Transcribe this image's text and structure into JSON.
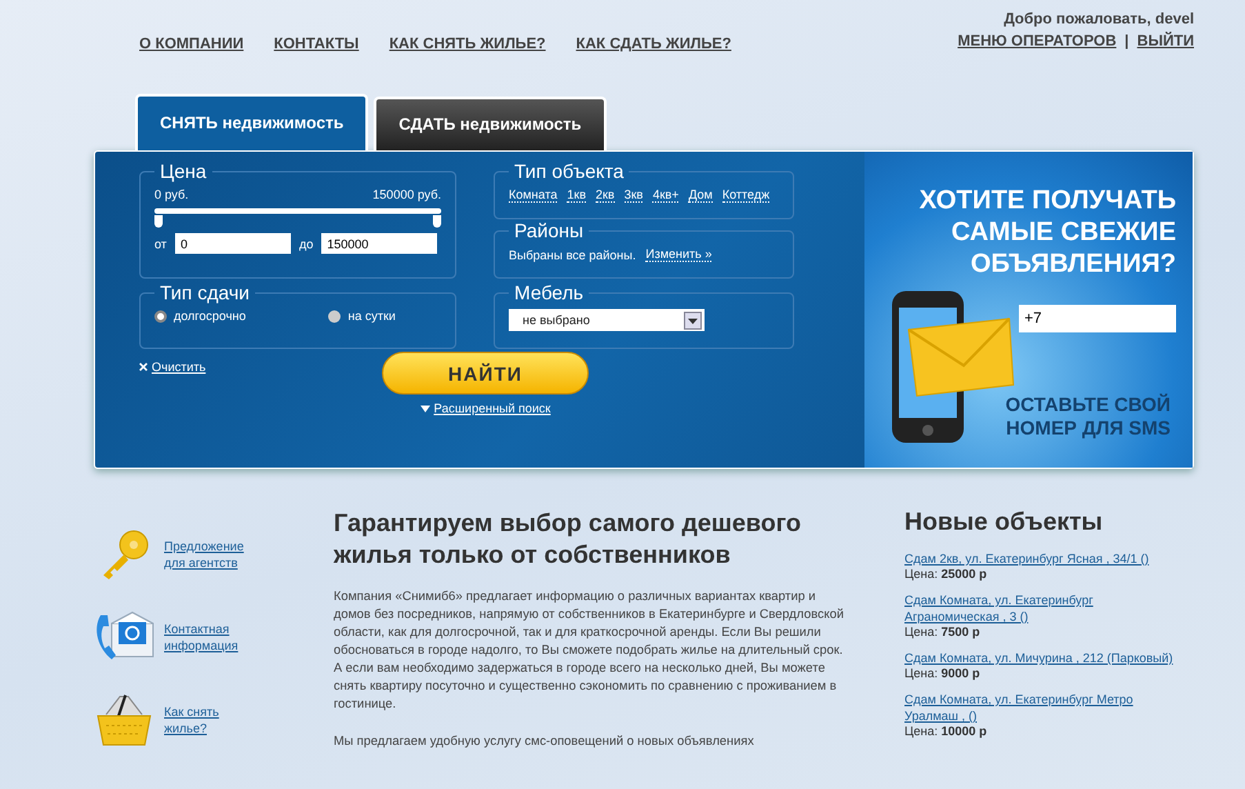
{
  "header": {
    "nav": [
      "О КОМПАНИИ",
      "КОНТАКТЫ",
      "КАК СНЯТЬ ЖИЛЬЕ?",
      "КАК СДАТЬ ЖИЛЬЕ?"
    ],
    "welcome": "Добро пожаловать, devel",
    "user_links": [
      "МЕНЮ ОПЕРАТОРОВ",
      "ВЫЙТИ"
    ],
    "separator": "|"
  },
  "tabs": [
    {
      "label": "СНЯТЬ недвижимость",
      "selected": true
    },
    {
      "label": "СДАТЬ недвижимость",
      "selected": false
    }
  ],
  "search": {
    "price": {
      "legend": "Цена",
      "min_label": "0 руб.",
      "max_label": "150000 руб.",
      "thumbs": [
        {
          "level": 0
        },
        {
          "level": 1
        }
      ],
      "from_label": "от",
      "from_value": "0",
      "to_label": "до",
      "to_value": "150000"
    },
    "rent_type": {
      "legend": "Тип сдачи",
      "options": [
        {
          "label": "долгосрочно",
          "selected": true
        },
        {
          "label": "на сутки",
          "selected": false
        }
      ]
    },
    "object_type": {
      "legend": "Тип объекта",
      "options": [
        "Комната",
        "1кв",
        "2кв",
        "3кв",
        "4кв+",
        "Дом",
        "Коттедж"
      ]
    },
    "districts": {
      "legend": "Районы",
      "text": "Выбраны все районы.",
      "link": "Изменить »"
    },
    "furniture": {
      "legend": "Мебель",
      "value": "не выбрано"
    },
    "clear": "Очистить",
    "submit": "НАЙТИ",
    "advanced": "Расширенный поиск"
  },
  "sms_banner": {
    "title": "ХОТИТЕ ПОЛУЧАТЬ САМЫЕ СВЕЖИЕ ОБЪЯВЛЕНИЯ?",
    "phone_value": "+7",
    "caption": "ОСТАВЬТЕ СВОЙ НОМЕР ДЛЯ SMS"
  },
  "sidebar": {
    "items": [
      {
        "kind": "key",
        "label": "Предложение для агентств"
      },
      {
        "kind": "contact",
        "label": "Контактная информация"
      },
      {
        "kind": "basket",
        "label": "Как снять жилье?"
      }
    ]
  },
  "main": {
    "title": "Гарантируем выбор самого дешевого жилья только от собственников",
    "paragraphs": [
      "Компания «Снимиб6» предлагает информацию о различных вариантах квартир и домов без посредников, напрямую от  собственников в Екатеринбурге и Свердловской области, как для долгосрочной, так и для краткосрочной аренды. Если Вы решили обосноваться в городе надолго, то Вы сможете подобрать жилье на длительный срок. А если вам необходимо задержаться в городе всего на несколько дней, Вы можете снять квартиру посуточно и существенно сэкономить по сравнению с проживанием в гостинице.",
      "Мы предлагаем удобную услугу смс-оповещений о новых объявлениях"
    ]
  },
  "new_objects": {
    "title": "Новые объекты",
    "items": [
      {
        "link": "Сдам 2кв, ул. Екатеринбург Ясная , 34/1 ()",
        "price": "Цена: **25000 р**"
      },
      {
        "link": "Сдам Комната, ул. Екатеринбург Аграномическая , 3 ()",
        "price": "Цена: **7500 р**"
      },
      {
        "link": "Сдам Комната, ул. Мичурина , 212 (Парковый)",
        "price": "Цена: **9000 р**"
      },
      {
        "link": "Сдам Комната, ул. Екатеринбург Метро Уралмаш , ()",
        "price": "Цена: **10000 р**"
      }
    ]
  }
}
